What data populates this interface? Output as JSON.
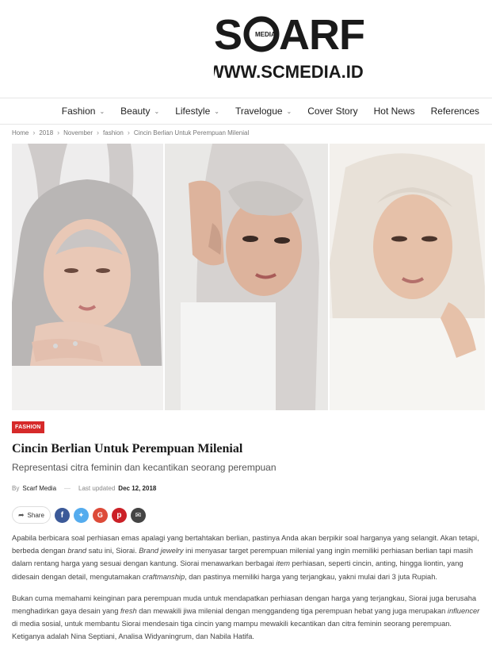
{
  "site": {
    "logo_main": "SC RF",
    "logo_badge": "MEDIA",
    "logo_url": "WWW.SCMEDIA.ID"
  },
  "nav": [
    {
      "label": "Fashion",
      "has_dropdown": true
    },
    {
      "label": "Beauty",
      "has_dropdown": true
    },
    {
      "label": "Lifestyle",
      "has_dropdown": true
    },
    {
      "label": "Travelogue",
      "has_dropdown": true
    },
    {
      "label": "Cover Story",
      "has_dropdown": false
    },
    {
      "label": "Hot News",
      "has_dropdown": false
    },
    {
      "label": "References",
      "has_dropdown": false
    }
  ],
  "breadcrumb": [
    "Home",
    "2018",
    "November",
    "fashion",
    "Cincin Berlian Untuk Perempuan Milenial"
  ],
  "article": {
    "category": "FASHION",
    "title": "Cincin Berlian Untuk Perempuan Milenial",
    "subtitle": "Representasi citra feminin dan kecantikan seorang perempuan",
    "by_label": "By",
    "author": "Scarf Media",
    "updated_label": "Last updated",
    "date": "Dec 12, 2018",
    "share_label": "Share",
    "paragraph1": {
      "s1": "Apabila berbicara soal perhiasan emas apalagi yang bertahtakan berlian, pastinya Anda akan berpikir soal harganya yang selangit. Akan tetapi, berbeda dengan ",
      "e1": "brand",
      "s2": " satu ini, Siorai. ",
      "e2": "Brand jewelry",
      "s3": " ini menyasar target perempuan milenial yang ingin memiliki perhiasan berlian tapi masih dalam rentang harga yang sesuai dengan kantung. Siorai menawarkan berbagai ",
      "e3": "item",
      "s4": " perhiasan, seperti cincin, anting, hingga liontin, yang didesain dengan detail, mengutamakan ",
      "e4": "craftmanship",
      "s5": ", dan pastinya memiliki harga yang terjangkau, yakni mulai dari 3 juta Rupiah."
    },
    "paragraph2": {
      "s1": "Bukan cuma memahami keinginan para perempuan muda untuk mendapatkan perhiasan dengan harga yang terjangkau, Siorai juga berusaha menghadirkan gaya desain yang ",
      "e1": "fresh",
      "s2": " dan mewakili jiwa milenial dengan menggandeng tiga perempuan hebat yang juga merupakan ",
      "e2": "influencer",
      "s3": " di media sosial, untuk membantu Siorai mendesain tiga cincin yang mampu mewakili kecantikan dan citra feminin seorang perempuan. Ketiganya adalah Nina Septiani, Analisa Widyaningrum, dan Nabila Hatifa."
    }
  },
  "colors": {
    "badge": "#d62a2a",
    "facebook": "#3b5998",
    "twitter": "#55acee",
    "google": "#dd4b39",
    "pinterest": "#cb2027",
    "email": "#444444"
  }
}
